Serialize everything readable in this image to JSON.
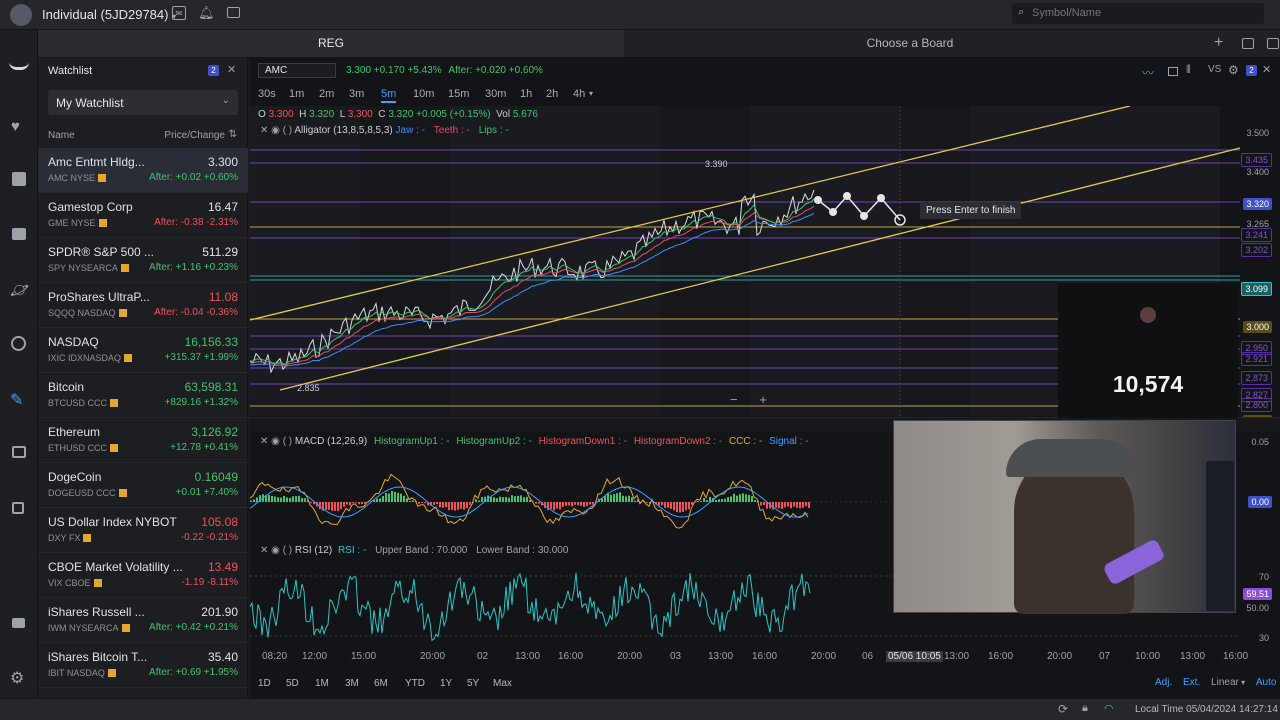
{
  "topbar": {
    "account": "Individual (5JD29784)",
    "search_placeholder": "Symbol/Name"
  },
  "tabs": {
    "left": "REG",
    "right": "Choose a Board"
  },
  "watchlist": {
    "header": "Watchlist",
    "count": "2",
    "selected": "My Watchlist",
    "col_name": "Name",
    "col_price": "Price/Change",
    "items": [
      {
        "name": "Amc Entmt Hldg...",
        "sub": "AMC NYSE",
        "price": "3.300",
        "price_color": "neutral",
        "chg": "After: +0.02 +0.60%",
        "chg_dir": "up"
      },
      {
        "name": "Gamestop Corp",
        "sub": "GME NYSE",
        "price": "16.47",
        "price_color": "neutral",
        "chg": "After: -0.38 -2.31%",
        "chg_dir": "down"
      },
      {
        "name": "SPDR® S&P 500 ...",
        "sub": "SPY NYSEARCA",
        "price": "511.29",
        "price_color": "neutral",
        "chg": "After: +1.16 +0.23%",
        "chg_dir": "up"
      },
      {
        "name": "ProShares UltraP...",
        "sub": "SQQQ NASDAQ",
        "price": "11.08",
        "price_color": "down",
        "chg": "After: -0.04 -0.36%",
        "chg_dir": "down"
      },
      {
        "name": "NASDAQ",
        "sub": "IXIC IDXNASDAQ",
        "price": "16,156.33",
        "price_color": "up",
        "chg": "+315.37 +1.99%",
        "chg_dir": "up"
      },
      {
        "name": "Bitcoin",
        "sub": "BTCUSD CCC",
        "price": "63,598.31",
        "price_color": "up",
        "chg": "+829.16 +1.32%",
        "chg_dir": "up"
      },
      {
        "name": "Ethereum",
        "sub": "ETHUSD CCC",
        "price": "3,126.92",
        "price_color": "up",
        "chg": "+12.78 +0.41%",
        "chg_dir": "up"
      },
      {
        "name": "DogeCoin",
        "sub": "DOGEUSD CCC",
        "price": "0.16049",
        "price_color": "up",
        "chg": "+0.01 +7.40%",
        "chg_dir": "up"
      },
      {
        "name": "US Dollar Index NYBOT",
        "sub": "DXY FX",
        "price": "105.08",
        "price_color": "down",
        "chg": "-0.22 -0.21%",
        "chg_dir": "down"
      },
      {
        "name": "CBOE Market Volatility ...",
        "sub": "VIX CBOE",
        "price": "13.49",
        "price_color": "down",
        "chg": "-1.19 -8.11%",
        "chg_dir": "down"
      },
      {
        "name": "iShares Russell ...",
        "sub": "IWM NYSEARCA",
        "price": "201.90",
        "price_color": "neutral",
        "chg": "After: +0.42 +0.21%",
        "chg_dir": "up"
      },
      {
        "name": "iShares Bitcoin T...",
        "sub": "IBIT NASDAQ",
        "price": "35.40",
        "price_color": "neutral",
        "chg": "After: +0.69 +1.95%",
        "chg_dir": "up"
      }
    ]
  },
  "chart": {
    "symbol": "AMC",
    "quote": "3.300 +0.170 +5.43%",
    "after": "After: +0.020 +0.60%",
    "timeframes": [
      "30s",
      "1m",
      "2m",
      "3m",
      "5m",
      "10m",
      "15m",
      "30m",
      "1h",
      "2h",
      "4h"
    ],
    "active_tf": "5m",
    "ohlc": {
      "o": "3.300",
      "h": "3.320",
      "l": "3.300",
      "c": "3.320",
      "chg": "+0.005 (+0.15%)",
      "vol": "5.676"
    },
    "indicator_main": "Alligator (13,8,5,8,5,3)",
    "indicator_main_legend": [
      "Jaw : -",
      "Teeth : -",
      "Lips : -"
    ],
    "high_label": "3.390",
    "low_label": "2.835",
    "tooltip": "Press Enter to finish",
    "macd_label": "MACD (12,26,9)",
    "macd_legend": [
      "HistogramUp1 : -",
      "HistogramUp2 : -",
      "HistogramDown1 : -",
      "HistogramDown2 : -",
      "CCC : -",
      "Signal : -"
    ],
    "rsi_label": "RSI (12)",
    "rsi_legend": [
      "RSI : -",
      "Upper Band : 70.000",
      "Lower Band : 30.000"
    ],
    "price_axis": [
      "3.500",
      "3.435",
      "3.400",
      "3.320",
      "3.265",
      "3.241",
      "3.202",
      "3.099",
      "3.000",
      "2.950",
      "2.921",
      "2.873",
      "2.827",
      "2.800",
      "2.756"
    ],
    "macd_axis": [
      "0.05",
      "0.00"
    ],
    "rsi_axis": [
      "70",
      "59.51",
      "50.00",
      "30"
    ],
    "time_axis": [
      "08:20",
      "12:00",
      "15:00",
      "20:00",
      "02",
      "13:00",
      "16:00",
      "20:00",
      "03",
      "13:00",
      "16:00",
      "20:00",
      "06",
      "05/06 10:05",
      "13:00",
      "16:00",
      "20:00",
      "07",
      "10:00",
      "13:00",
      "16:00"
    ],
    "ranges": [
      "1D",
      "5D",
      "1M",
      "3M",
      "6M",
      "YTD",
      "1Y",
      "5Y",
      "Max"
    ],
    "bottom_right": [
      "Adj.",
      "Ext.",
      "Linear",
      "Auto"
    ]
  },
  "overlay": {
    "viewers": "10,574"
  },
  "status": {
    "local_time": "Local Time 05/04/2024 14:27:14"
  },
  "colors": {
    "accent": "#3aa0ff",
    "up": "#3ec46d",
    "down": "#f0505a",
    "channel": "#e6c84a",
    "purple": "#8a4fd8",
    "cyan": "#2dc4c4"
  }
}
